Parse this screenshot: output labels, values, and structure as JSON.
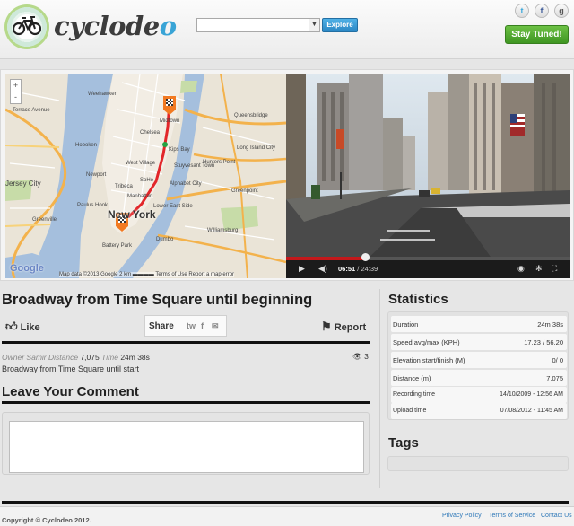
{
  "brand": {
    "name_main": "cyclode",
    "name_accent": "o"
  },
  "header": {
    "select_value": "",
    "explore_label": "Explore",
    "social": [
      "t",
      "f",
      "g"
    ],
    "stay_tuned_label": "Stay Tuned!"
  },
  "map": {
    "city_label": "New York",
    "zoom_in": "+",
    "zoom_out": "-",
    "google": "Google",
    "footer_text": "Map data ©2013 Google   2 km ▬▬▬▬   Terms of Use   Report a map error",
    "labels": [
      "Weehawken",
      "Terrace Avenue",
      "Hoboken",
      "Newport",
      "Jersey City",
      "Paulus Hook",
      "Greenville",
      "Battery Park",
      "Midtown",
      "Chelsea",
      "West Village",
      "SoHo",
      "Tribeca",
      "Manhattan",
      "Kips Bay",
      "Stuyvesant Town",
      "Alphabet City",
      "Lower East Side",
      "Dumbo",
      "Queensbridge",
      "Long Island City",
      "Greenpoint",
      "Williamsburg",
      "Hunters Point"
    ],
    "route_color": "#e2262a"
  },
  "video": {
    "current_time": "06:51",
    "duration": "24:39",
    "progress": 0.28
  },
  "ride": {
    "title": "Broadway from Time Square until beginning",
    "like_label": "Like",
    "share_label": "Share",
    "share_icons": [
      "tw",
      "f",
      "✉"
    ],
    "report_label": "Report",
    "owner_label": "Owner",
    "owner": "Samir",
    "distance_label": "Distance",
    "distance": "7,075",
    "time_label": "Time",
    "time": "24m 38s",
    "views": "3",
    "description": "Broadway from Time Square until start"
  },
  "comment": {
    "heading": "Leave Your Comment",
    "value": ""
  },
  "statistics": {
    "heading": "Statistics",
    "rows": [
      {
        "label": "Duration",
        "value": "24m 38s"
      },
      {
        "label": "Speed avg/max (KPH)",
        "value": "17.23 / 56.20"
      },
      {
        "label": "Elevation start/finish (M)",
        "value": "0/ 0"
      },
      {
        "label": "Distance (m)",
        "value": "7,075"
      },
      {
        "label": "Recording time",
        "value": "14/10/2009 - 12:56 AM"
      },
      {
        "label": "Upload time",
        "value": "07/08/2012 - 11:45 AM"
      }
    ]
  },
  "tags": {
    "heading": "Tags"
  },
  "footer": {
    "copyright": "Copyright © Cyclodeo 2012.",
    "links": [
      "Privacy Policy",
      "Terms of Service",
      "Contact Us"
    ]
  },
  "colors": {
    "accent_blue": "#39a4d6",
    "green": "#4caf2c",
    "progress_red": "#c4181b"
  }
}
